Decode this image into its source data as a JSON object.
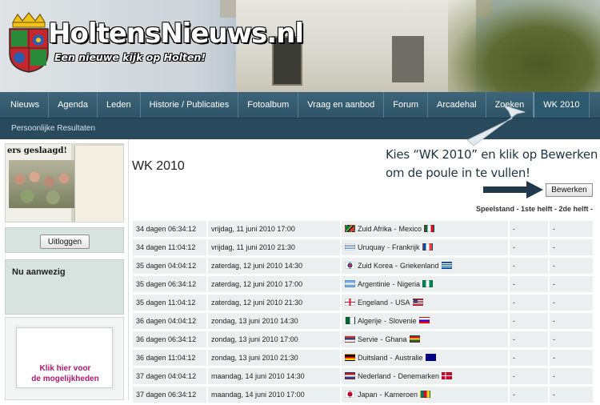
{
  "header": {
    "site_title": "HoltensNieuws.nl",
    "tagline": "Een nieuwe kijk op Holten!"
  },
  "nav": {
    "items": [
      "Nieuws",
      "Agenda",
      "Leden",
      "Historie / Publicaties",
      "Fotoalbum",
      "Vraag en aanbod",
      "Forum",
      "Arcadehal",
      "Zoeken",
      "WK 2010"
    ],
    "active": "WK 2010"
  },
  "subnav": {
    "link": "Persoonlijke Resultaten"
  },
  "sidebar": {
    "photo_headline": "ers geslaagd!",
    "logout_label": "Uitloggen",
    "online_title": "Nu aanwezig",
    "ad_line1": "Klik hier voor",
    "ad_line2": "de mogelijkheden"
  },
  "main": {
    "title": "WK 2010",
    "annotation_line1": "Kies “WK 2010” en klik op Bewerken",
    "annotation_line2": "om de poule in te vullen!",
    "edit_label": "Bewerken",
    "score_headers": "Speelstand - 1ste helft - 2de helft -",
    "matches": [
      {
        "countdown": "34 dagen 06:34:12",
        "date": "vrijdag, 11 juni 2010 17:00",
        "home": "Zuid Afrika",
        "away": "Mexico",
        "home_flag": "south-africa-flag",
        "away_flag": "mexico-flag",
        "s1": "-",
        "s2": "-"
      },
      {
        "countdown": "34 dagen 11:04:12",
        "date": "vrijdag, 11 juni 2010 21:30",
        "home": "Uruquay",
        "away": "Frankrijk",
        "home_flag": "uruguay-flag",
        "away_flag": "france-flag",
        "s1": "-",
        "s2": "-"
      },
      {
        "countdown": "35 dagen 04:04:12",
        "date": "zaterdag, 12 juni 2010 14:30",
        "home": "Zuid Korea",
        "away": "Griekenland",
        "home_flag": "south-korea-flag",
        "away_flag": "greece-flag",
        "s1": "-",
        "s2": "-"
      },
      {
        "countdown": "35 dagen 06:34:12",
        "date": "zaterdag, 12 juni 2010 17:00",
        "home": "Argentinie",
        "away": "Nigeria",
        "home_flag": "argentina-flag",
        "away_flag": "nigeria-flag",
        "s1": "-",
        "s2": "-"
      },
      {
        "countdown": "35 dagen 11:04:12",
        "date": "zaterdag, 12 juni 2010 21:30",
        "home": "Engeland",
        "away": "USA",
        "home_flag": "england-flag",
        "away_flag": "usa-flag",
        "s1": "-",
        "s2": "-"
      },
      {
        "countdown": "36 dagen 04:04:12",
        "date": "zondag, 13 juni 2010 14:30",
        "home": "Algerije",
        "away": "Slovenie",
        "home_flag": "algeria-flag",
        "away_flag": "slovenia-flag",
        "s1": "-",
        "s2": "-"
      },
      {
        "countdown": "36 dagen 06:34:12",
        "date": "zondag, 13 juni 2010 17:00",
        "home": "Servie",
        "away": "Ghana",
        "home_flag": "serbia-flag",
        "away_flag": "ghana-flag",
        "s1": "-",
        "s2": "-"
      },
      {
        "countdown": "36 dagen 11:04:12",
        "date": "zondag, 13 juni 2010 21:30",
        "home": "Duitsland",
        "away": "Australie",
        "home_flag": "germany-flag",
        "away_flag": "australia-flag",
        "s1": "-",
        "s2": "-"
      },
      {
        "countdown": "37 dagen 04:04:12",
        "date": "maandag, 14 juni 2010 14:30",
        "home": "Nederland",
        "away": "Denemarken",
        "home_flag": "netherlands-flag",
        "away_flag": "denmark-flag",
        "s1": "-",
        "s2": "-"
      },
      {
        "countdown": "37 dagen 06:34:12",
        "date": "maandag, 14 juni 2010 17:00",
        "home": "Japan",
        "away": "Kameroen",
        "home_flag": "japan-flag",
        "away_flag": "cameroon-flag",
        "s1": "-",
        "s2": "-"
      }
    ]
  },
  "colors": {
    "nav_bg": "#2f5468",
    "subnav_bg": "#284a5c",
    "panel_bg": "#d8e3e0",
    "row_bg": "#eceff0",
    "ad_text": "#b0166e",
    "annotation": "#1a3446"
  }
}
